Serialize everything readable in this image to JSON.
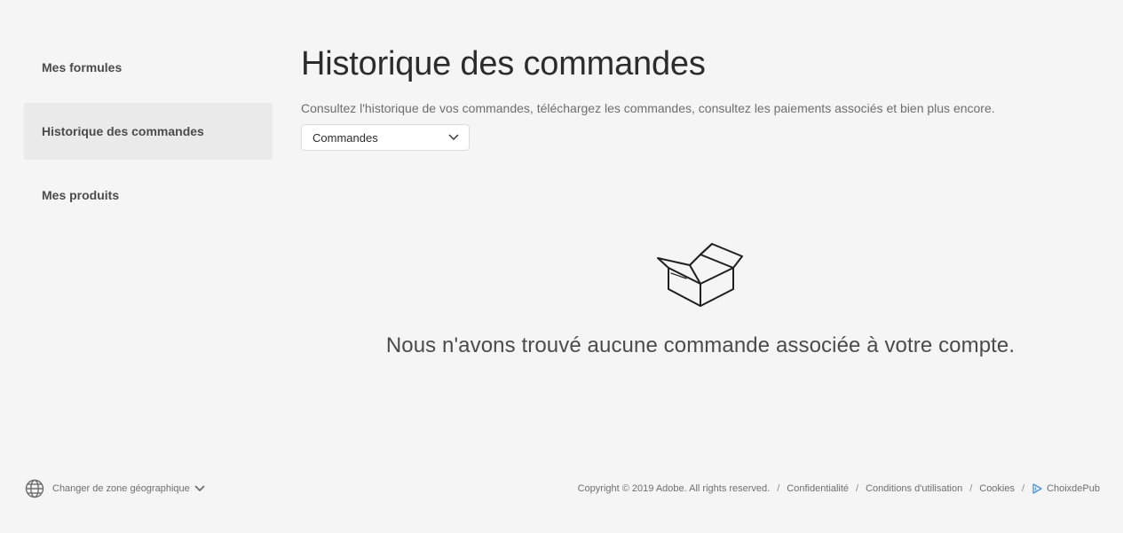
{
  "sidebar": {
    "items": [
      {
        "label": "Mes formules",
        "active": false
      },
      {
        "label": "Historique des commandes",
        "active": true
      },
      {
        "label": "Mes produits",
        "active": false
      }
    ]
  },
  "main": {
    "title": "Historique des commandes",
    "description": "Consultez l'historique de vos commandes, téléchargez les commandes, consultez les paiements associés et bien plus encore.",
    "filter": {
      "selected": "Commandes"
    },
    "empty_state": {
      "icon": "open-box-icon",
      "message": "Nous n'avons trouvé aucune commande associée à votre compte."
    }
  },
  "footer": {
    "region_label": "Changer de zone géographique",
    "copyright": "Copyright © 2019 Adobe. All rights reserved.",
    "links": {
      "privacy": "Confidentialité",
      "terms": "Conditions d'utilisation",
      "cookies": "Cookies",
      "adchoices": "ChoixdePub"
    },
    "separator": "/"
  },
  "colors": {
    "background": "#f5f5f5",
    "active_item": "#eaeaea",
    "text": "#2c2c2c",
    "muted_text": "#6e6e6e",
    "adchoice_accent": "#4a90d9"
  }
}
